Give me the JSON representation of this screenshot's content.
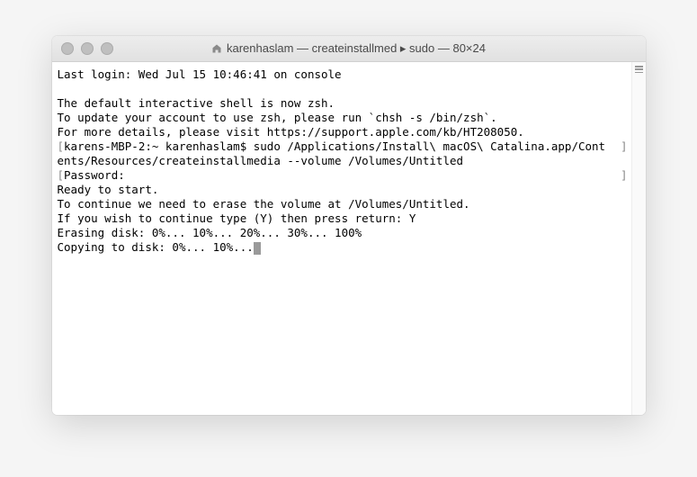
{
  "window": {
    "title": "karenhaslam — createinstallmed ▸ sudo — 80×24"
  },
  "terminal": {
    "lines": [
      {
        "type": "plain",
        "text": "Last login: Wed Jul 15 10:46:41 on console"
      },
      {
        "type": "blank",
        "text": ""
      },
      {
        "type": "plain",
        "text": "The default interactive shell is now zsh."
      },
      {
        "type": "plain",
        "text": "To update your account to use zsh, please run `chsh -s /bin/zsh`."
      },
      {
        "type": "plain",
        "text": "For more details, please visit https://support.apple.com/kb/HT208050."
      },
      {
        "type": "prompt",
        "text": "karens-MBP-2:~ karenhaslam$ sudo /Applications/Install\\ macOS\\ Catalina.app/Cont"
      },
      {
        "type": "plain",
        "text": "ents/Resources/createinstallmedia --volume /Volumes/Untitled"
      },
      {
        "type": "prompt",
        "text": "Password:"
      },
      {
        "type": "plain",
        "text": "Ready to start."
      },
      {
        "type": "plain",
        "text": "To continue we need to erase the volume at /Volumes/Untitled."
      },
      {
        "type": "plain",
        "text": "If you wish to continue type (Y) then press return: Y"
      },
      {
        "type": "plain",
        "text": "Erasing disk: 0%... 10%... 20%... 30%... 100%"
      },
      {
        "type": "cursor",
        "text": "Copying to disk: 0%... 10%..."
      }
    ]
  }
}
